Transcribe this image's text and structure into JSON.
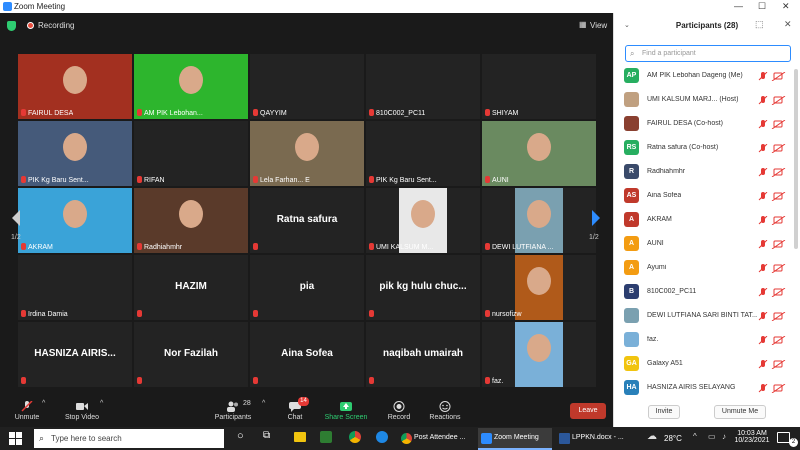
{
  "window": {
    "title": "Zoom Meeting"
  },
  "meeting": {
    "recording_label": "Recording",
    "view_label": "View",
    "page_indicator_left": "1/2",
    "page_indicator_right": "1/2"
  },
  "tiles": [
    {
      "name": "FAIRUL DESA",
      "type": "video",
      "bg": "#a33020"
    },
    {
      "name": "AM PIK Lebohan...",
      "type": "video",
      "bg": "#2db52d"
    },
    {
      "name": "QAYYIM",
      "type": "blank"
    },
    {
      "name": "810C002_PC11",
      "type": "blank"
    },
    {
      "name": "SHIYAM",
      "type": "blank"
    },
    {
      "name": "PIK Kg Baru Sent...",
      "type": "video",
      "bg": "#455a7a"
    },
    {
      "name": "RIFAN",
      "type": "blank"
    },
    {
      "name": "Lela Farhan... E",
      "type": "video",
      "bg": "#7a6a50"
    },
    {
      "name": "PIK Kg Baru Sent...",
      "type": "blank"
    },
    {
      "name": "AUNI",
      "type": "video",
      "bg": "#6a8a60"
    },
    {
      "name": "AKRAM",
      "type": "video",
      "bg": "#3aa3d8"
    },
    {
      "name": "Radhiahmhr",
      "type": "video",
      "bg": "#5a3a2a"
    },
    {
      "name": "",
      "big": "Ratna safura",
      "type": "text"
    },
    {
      "name": "UMI KALSUM M...",
      "type": "photo",
      "bg": "#e8e8e8"
    },
    {
      "name": "DEWI LUTFIANA ...",
      "type": "photo",
      "bg": "#7aa0b0"
    },
    {
      "name": "Irdina Damia",
      "type": "blank"
    },
    {
      "name": "",
      "big": "HAZIM",
      "type": "text"
    },
    {
      "name": "",
      "big": "pia",
      "type": "text"
    },
    {
      "name": "",
      "big": "pik kg hulu chuc...",
      "type": "text"
    },
    {
      "name": "nursofizw",
      "type": "photo",
      "bg": "#b05a1a"
    },
    {
      "name": "",
      "big": "HASNIZA AIRIS...",
      "type": "text"
    },
    {
      "name": "",
      "big": "Nor Fazilah",
      "type": "text"
    },
    {
      "name": "",
      "big": "Aina Sofea",
      "type": "text"
    },
    {
      "name": "",
      "big": "naqibah umairah",
      "type": "text"
    },
    {
      "name": "faz.",
      "type": "photo",
      "bg": "#7ab0d8"
    }
  ],
  "toolbar": {
    "unmute": "Unmute",
    "stop_video": "Stop Video",
    "participants": "Participants",
    "participants_count": "28",
    "chat": "Chat",
    "chat_badge": "14",
    "share_screen": "Share Screen",
    "record": "Record",
    "reactions": "Reactions",
    "leave": "Leave"
  },
  "panel": {
    "title": "Participants (28)",
    "search_placeholder": "Find a participant",
    "invite": "Invite",
    "unmute_me": "Unmute Me",
    "participants": [
      {
        "initials": "AP",
        "color": "#27ae60",
        "name": "AM PIK Lebohan Dageng (Me)"
      },
      {
        "initials": "",
        "color": "#c0a080",
        "name": "UMI KALSUM MARJ...   (Host)"
      },
      {
        "initials": "",
        "color": "#8a4030",
        "name": "FAIRUL DESA (Co-host)"
      },
      {
        "initials": "RS",
        "color": "#27ae60",
        "name": "Ratna safura (Co-host)"
      },
      {
        "initials": "R",
        "color": "#3a4a6a",
        "name": "Radhiahmhr"
      },
      {
        "initials": "AS",
        "color": "#c0392b",
        "name": "Aina Sofea"
      },
      {
        "initials": "A",
        "color": "#c0392b",
        "name": "AKRAM"
      },
      {
        "initials": "A",
        "color": "#f39c12",
        "name": "AUNI"
      },
      {
        "initials": "A",
        "color": "#f39c12",
        "name": "Ayumi"
      },
      {
        "initials": "B",
        "color": "#2c3e70",
        "name": "810C002_PC11"
      },
      {
        "initials": "",
        "color": "#7aa0b0",
        "name": "DEWI LUTFIANA SARI BINTI TAT..."
      },
      {
        "initials": "",
        "color": "#7ab0d8",
        "name": "faz."
      },
      {
        "initials": "GA",
        "color": "#f1c40f",
        "name": "Galaxy A51"
      },
      {
        "initials": "HA",
        "color": "#2980b9",
        "name": "HASNIZA AIRIS SELAYANG"
      }
    ]
  },
  "taskbar": {
    "search_placeholder": "Type here to search",
    "task_edge": "Post Attendee ...",
    "task_zoom": "Zoom Meeting",
    "task_word": "LPPKN.docx - ...",
    "temperature": "28°C",
    "time": "10:03 AM",
    "date": "10/23/2021",
    "notif_count": "2"
  },
  "colors": {
    "accent": "#2d8cff",
    "leave": "#c0392b",
    "muted_mic": "#e53935",
    "active_speaker": "#f2e600",
    "share_green": "#2ecc71"
  }
}
